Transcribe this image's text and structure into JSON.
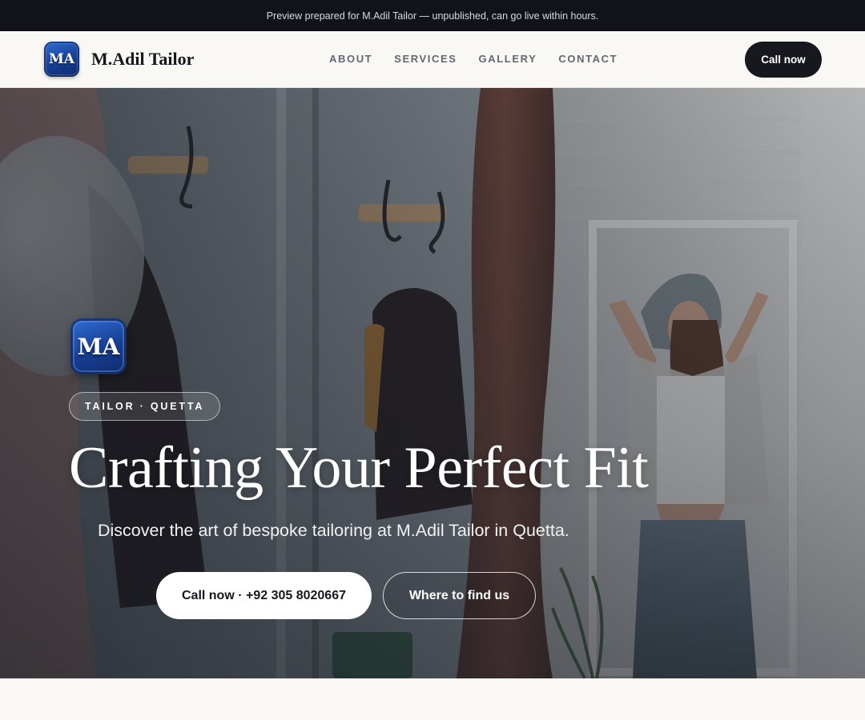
{
  "preview_notice": "Preview prepared for M.Adil Tailor — unpublished, can go live within hours.",
  "header": {
    "logo_initials": "MA",
    "brand_name": "M.Adil Tailor",
    "nav": [
      "ABOUT",
      "SERVICES",
      "GALLERY",
      "CONTACT"
    ],
    "cta_label": "Call now"
  },
  "hero": {
    "logo_initials": "MA",
    "eyebrow": "TAILOR · QUETTA",
    "title": "Crafting Your Perfect Fit",
    "subtitle": "Discover the art of bespoke tailoring at M.Adil Tailor in Quetta.",
    "primary_cta": "Call now · +92 305 8020667",
    "secondary_cta": "Where to find us"
  },
  "colors": {
    "preview_bar": "#111318",
    "header_bg": "#f9f8f5",
    "dark_button": "#16181d",
    "logo_blue": "#173e93",
    "nav_text": "#626775"
  },
  "icons": [
    "logo-badge-icon"
  ]
}
